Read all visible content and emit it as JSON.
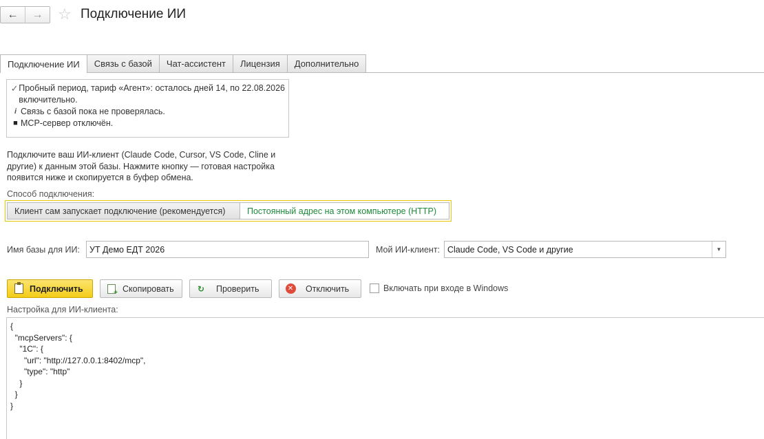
{
  "window": {
    "title": "Подключение ИИ",
    "back_icon": "←",
    "forward_icon": "→",
    "star_icon": "☆"
  },
  "tabs": [
    {
      "label": "Подключение ИИ",
      "active": true
    },
    {
      "label": "Связь с базой",
      "active": false
    },
    {
      "label": "Чат-ассистент",
      "active": false
    },
    {
      "label": "Лицензия",
      "active": false
    },
    {
      "label": "Дополнительно",
      "active": false
    }
  ],
  "status": {
    "trial": "Пробный период, тариф «Агент»: осталось дней 14, по 22.08.2026 включительно.",
    "connection": "Связь с базой пока не проверялась.",
    "mcp": "MCP-сервер отключён."
  },
  "description": "Подключите ваш ИИ-клиент (Claude Code, Cursor, VS Code, Cline и другие) к данным этой базы. Нажмите кнопку — готовая настройка появится ниже и скопируется в буфер обмена.",
  "connection_method": {
    "label": "Способ подключения:",
    "options": [
      "Клиент сам запускает подключение (рекомендуется)",
      "Постоянный адрес на этом компьютере (HTTP)"
    ],
    "selected_index": 1,
    "selected_color": "#1d8a3a"
  },
  "base_name": {
    "label": "Имя базы для ИИ:",
    "value": "УТ Демо ЕДТ 2026"
  },
  "ai_client": {
    "label": "Мой ИИ-клиент:",
    "value": "Claude Code, VS Code и другие"
  },
  "buttons": {
    "connect": "Подключить",
    "copy": "Скопировать",
    "check": "Проверить",
    "disconnect": "Отключить"
  },
  "autostart": {
    "label": "Включать при входе в Windows",
    "checked": false
  },
  "settings": {
    "label": "Настройка для ИИ-клиента:",
    "code": "{\n  \"mcpServers\": {\n    \"1C\": {\n      \"url\": \"http://127.0.0.1:8402/mcp\",\n      \"type\": \"http\"\n    }\n  }\n}"
  },
  "colors": {
    "accent_yellow": "#f3cc18",
    "focus_border": "#e6c800"
  }
}
